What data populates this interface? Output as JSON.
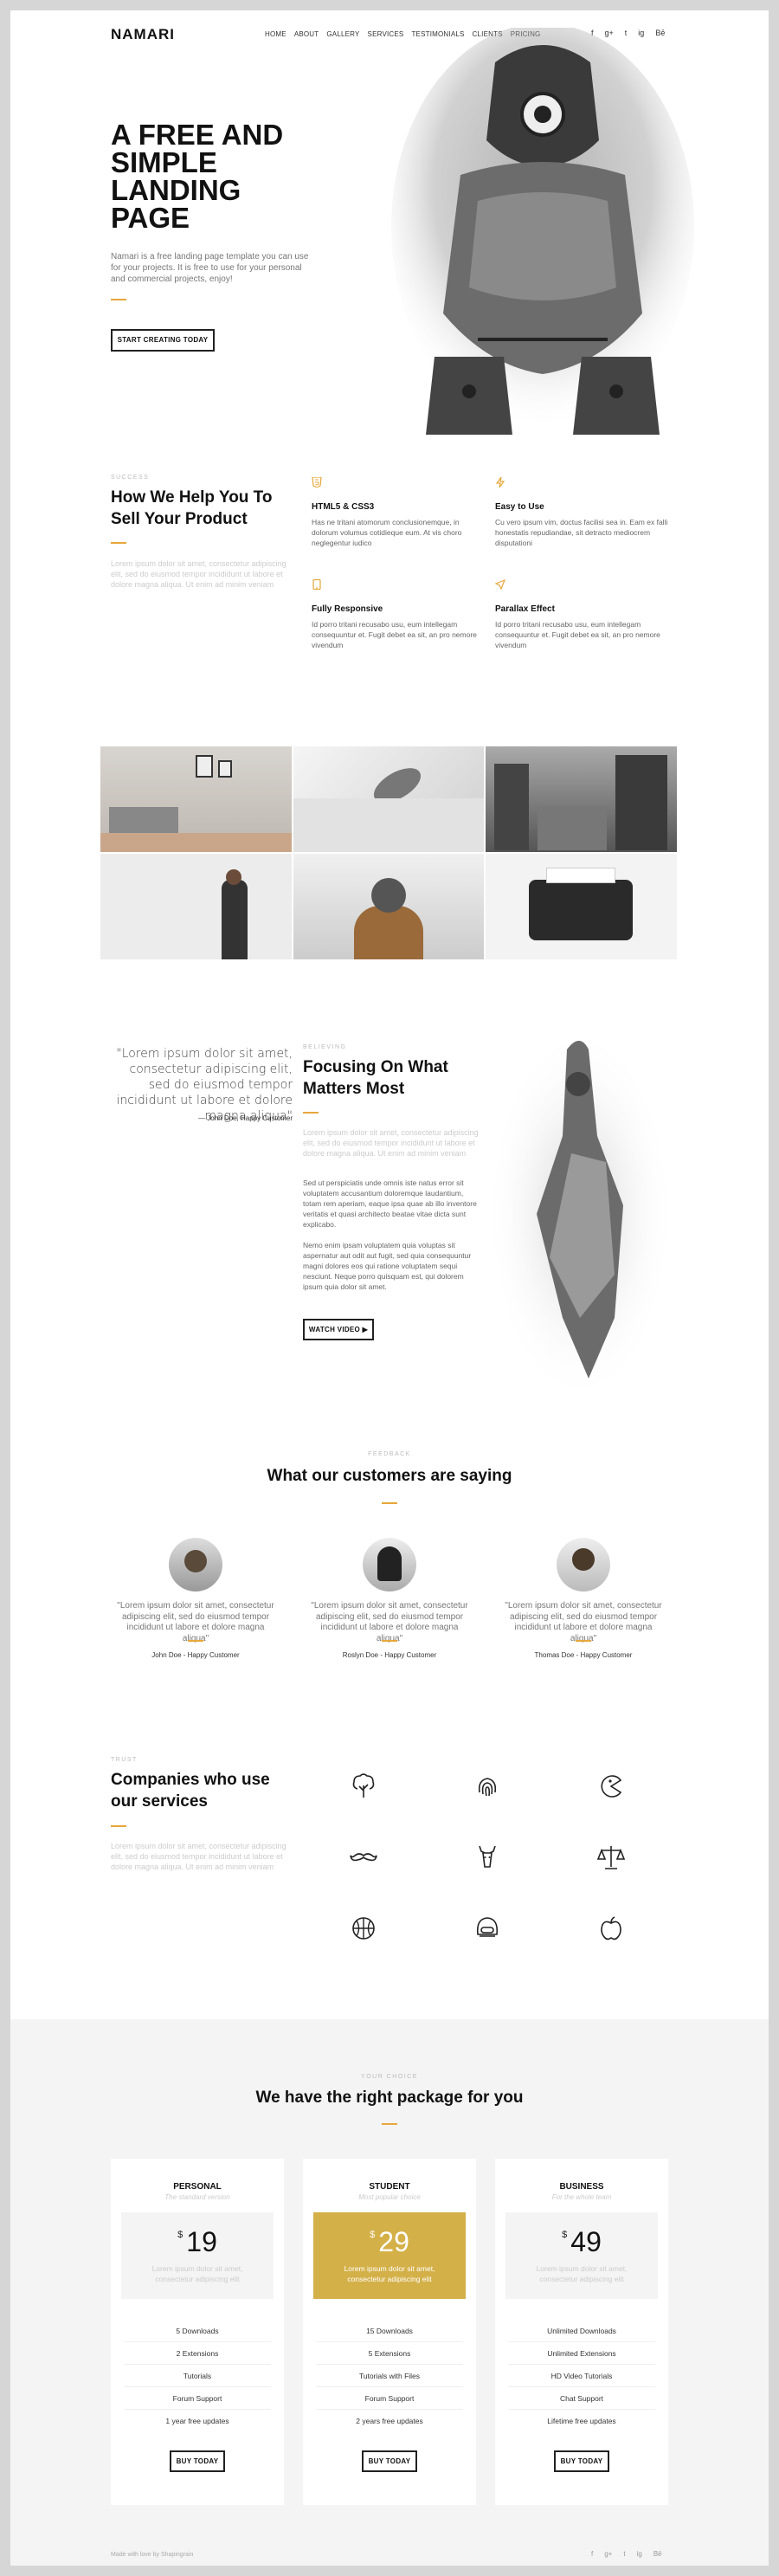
{
  "brand": "NAMARI",
  "nav": [
    "Home",
    "About",
    "Gallery",
    "Services",
    "Testimonials",
    "Clients",
    "Pricing"
  ],
  "social": [
    "f",
    "g+",
    "t",
    "ig",
    "Bē"
  ],
  "hero": {
    "title": "A Free and Simple Landing Page",
    "text": "Namari is a free landing page template you can use for your projects. It is free to use for your personal and commercial projects, enjoy!",
    "button": "Start creating today"
  },
  "help": {
    "kicker": "Success",
    "title": "How We Help You To Sell Your Product",
    "text": "Lorem ipsum dolor sit amet, consectetur adipiscing elit, sed do eiusmod tempor incididunt ut labore et dolore magna aliqua. Ut enim ad minim veniam",
    "features": [
      {
        "icon": "html5-icon",
        "title": "HTML5 & CSS3",
        "text": "Has ne tritani atomorum conclusionemque, in dolorum volumus cotidieque eum. At vis choro neglegentur iudico"
      },
      {
        "icon": "bolt-icon",
        "title": "Easy to Use",
        "text": "Cu vero ipsum vim, doctus facilisi sea in. Eam ex falli honestatis repudiandae, sit detracto mediocrem disputationi"
      },
      {
        "icon": "mobile-icon",
        "title": "Fully Responsive",
        "text": "Id porro tritani recusabo usu, eum intellegam consequuntur et. Fugit debet ea sit, an pro nemore vivendum"
      },
      {
        "icon": "rocket-icon",
        "title": "Parallax Effect",
        "text": "Id porro tritani recusabo usu, eum intellegam consequuntur et. Fugit debet ea sit, an pro nemore vivendum"
      }
    ]
  },
  "belief": {
    "quote": "\"Lorem ipsum dolor sit amet, consectetur adipiscing elit, sed do eiusmod tempor incididunt ut labore et dolore magna aliqua\"",
    "author": "— John Doe, Happy Customer",
    "kicker": "Believing",
    "title": "Focusing On What Matters Most",
    "lead": "Lorem ipsum dolor sit amet, consectetur adipiscing elit, sed do eiusmod tempor incididunt ut labore et dolore magna aliqua. Ut enim ad minim veniam",
    "para1": "Sed ut perspiciatis unde omnis iste natus error sit voluptatem accusantium doloremque laudantium, totam rem aperiam, eaque ipsa quae ab illo inventore veritatis et quasi architecto beatae vitae dicta sunt explicabo.",
    "para2": "Nemo enim ipsam voluptatem quia voluptas sit aspernatur aut odit aut fugit, sed quia consequuntur magni dolores eos qui ratione voluptatem sequi nesciunt. Neque porro quisquam est, qui dolorem ipsum quia dolor sit amet.",
    "button": "Watch video ▶"
  },
  "testimonials": {
    "kicker": "Feedback",
    "title": "What our customers are saying",
    "items": [
      {
        "text": "\"Lorem ipsum dolor sit amet, consectetur adipiscing elit, sed do eiusmod tempor incididunt ut labore et dolore magna aliqua\"",
        "name": "John Doe - Happy Customer"
      },
      {
        "text": "\"Lorem ipsum dolor sit amet, consectetur adipiscing elit, sed do eiusmod tempor incididunt ut labore et dolore magna aliqua\"",
        "name": "Roslyn Doe - Happy Customer"
      },
      {
        "text": "\"Lorem ipsum dolor sit amet, consectetur adipiscing elit, sed do eiusmod tempor incididunt ut labore et dolore magna aliqua\"",
        "name": "Thomas Doe - Happy Customer"
      }
    ]
  },
  "companies": {
    "kicker": "Trust",
    "title": "Companies who use our services",
    "text": "Lorem ipsum dolor sit amet, consectetur adipiscing elit, sed do eiusmod tempor incididunt ut labore et dolore magna aliqua. Ut enim ad minim veniam",
    "icons": [
      "tree-icon",
      "fingerprint-icon",
      "pacman-icon",
      "mustache-icon",
      "deer-icon",
      "scales-icon",
      "basketball-icon",
      "diving-helmet-icon",
      "apple-icon"
    ]
  },
  "pricing": {
    "kicker": "Your choice",
    "title": "We have the right package for you",
    "plans": [
      {
        "name": "Personal",
        "sub": "The standard version",
        "currency": "$",
        "price": "19",
        "desc": "Lorem ipsum dolor sit amet, consectetur adipiscing elit",
        "features": [
          "5 Downloads",
          "2 Extensions",
          "Tutorials",
          "Forum Support",
          "1 year free updates"
        ],
        "button": "Buy today"
      },
      {
        "name": "Student",
        "sub": "Most popular choice",
        "currency": "$",
        "price": "29",
        "desc": "Lorem ipsum dolor sit amet, consectetur adipiscing elit",
        "features": [
          "15 Downloads",
          "5 Extensions",
          "Tutorials with Files",
          "Forum Support",
          "2 years free updates"
        ],
        "button": "Buy today"
      },
      {
        "name": "Business",
        "sub": "For the whole team",
        "currency": "$",
        "price": "49",
        "desc": "Lorem ipsum dolor sit amet, consectetur adipiscing elit",
        "features": [
          "Unlimited Downloads",
          "Unlimited Extensions",
          "HD Video Tutorials",
          "Chat Support",
          "Lifetime free updates"
        ],
        "button": "Buy today"
      }
    ]
  },
  "footer": {
    "text": "Made with love by Shapingrain"
  },
  "colors": {
    "accent": "#e7a73b",
    "highlight": "#d4b048",
    "pricing_bg": "#f4f4f4"
  }
}
